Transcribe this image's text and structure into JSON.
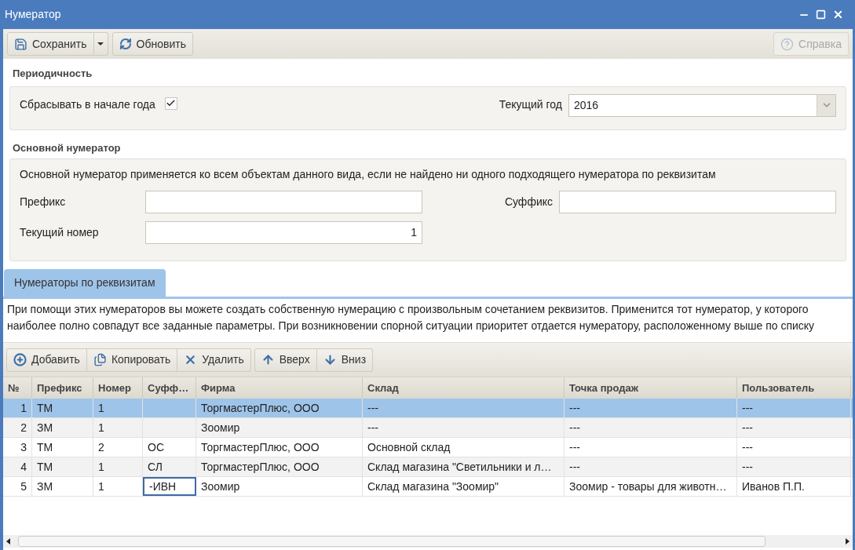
{
  "window": {
    "title": "Нумератор"
  },
  "toolbar": {
    "save": "Сохранить",
    "refresh": "Обновить",
    "help": {
      "label": "Справка",
      "disabled": true
    }
  },
  "periodicity": {
    "title": "Периодичность",
    "reset_label": "Сбрасывать в начале года",
    "reset_checked": true,
    "year_label": "Текущий год",
    "year_value": "2016"
  },
  "main_numerator": {
    "title": "Основной нумератор",
    "description": "Основной нумератор применяется ко всем объектам данного вида, если не найдено ни одного подходящего нумератора по реквизитам",
    "prefix_label": "Префикс",
    "suffix_label": "Суффикс",
    "number_label": "Текущий номер",
    "number_value": "1"
  },
  "tabs": [
    {
      "label": "Нумераторы по реквизитам",
      "selected": true
    }
  ],
  "description": "При помощи этих нумераторов вы можете создать собственную нумерацию с произвольным сочетанием реквизитов. Применится тот нумератор, у которого наиболее полно совпадут все заданные параметры. При возникновении спорной ситуации приоритет отдается нумератору, расположенному выше по списку",
  "table_toolbar": [
    {
      "kind": "add",
      "label": "Добавить"
    },
    {
      "kind": "copy",
      "label": "Копировать"
    },
    {
      "kind": "delete",
      "label": "Удалить"
    },
    {
      "kind": "up",
      "label": "Вверх"
    },
    {
      "kind": "down",
      "label": "Вниз"
    }
  ],
  "table": {
    "columns": [
      "№",
      "Префикс",
      "Номер",
      "Суфф…",
      "Фирма",
      "Склад",
      "Точка продаж",
      "Пользователь"
    ],
    "rows": [
      {
        "cells": [
          "1",
          "ТМ",
          "1",
          "",
          "ТоргмастерПлюс, ООО",
          "---",
          "---",
          "---"
        ],
        "selected": true,
        "suffix_focused": false
      },
      {
        "cells": [
          "2",
          "ЗМ",
          "1",
          "",
          "Зоомир",
          "---",
          "---",
          "---"
        ],
        "selected": false,
        "suffix_focused": false
      },
      {
        "cells": [
          "3",
          "ТМ",
          "2",
          "ОС",
          "ТоргмастерПлюс, ООО",
          "Основной склад",
          "---",
          "---"
        ],
        "selected": false,
        "suffix_focused": false
      },
      {
        "cells": [
          "4",
          "ТМ",
          "1",
          "СЛ",
          "ТоргмастерПлюс, ООО",
          "Склад магазина \"Светильники и л…",
          "---",
          "---"
        ],
        "selected": false,
        "suffix_focused": false
      },
      {
        "cells": [
          "5",
          "ЗМ",
          "1",
          "-ИВН",
          "Зоомир",
          "Склад магазина \"Зоомир\"",
          "Зоомир - товары для животн…",
          "Иванов П.П."
        ],
        "selected": false,
        "suffix_focused": true
      }
    ]
  }
}
